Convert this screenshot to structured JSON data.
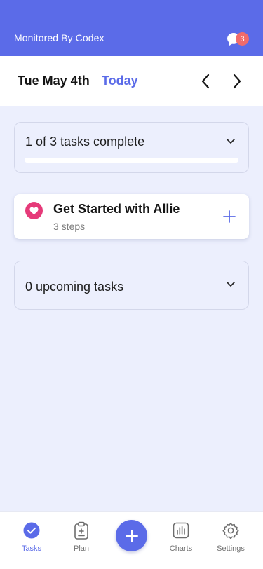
{
  "header": {
    "monitored_text": "Monitored By Codex",
    "chat_icon": "chat-bubbles-icon",
    "chat_badge_count": "3",
    "bg_color": "#5b6be8"
  },
  "date_bar": {
    "date": "Tue May 4th",
    "today_label": "Today",
    "prev_icon": "chevron-left-icon",
    "next_icon": "chevron-right-icon"
  },
  "summary": {
    "text": "1 of 3 tasks complete",
    "progress_fraction": 0,
    "expand_icon": "chevron-down-icon"
  },
  "task": {
    "title": "Get Started with Allie",
    "subtitle": "3 steps",
    "icon": "heart-icon",
    "icon_color": "#e63a79",
    "add_icon": "plus-icon"
  },
  "upcoming": {
    "text": "0 upcoming tasks",
    "expand_icon": "chevron-down-icon"
  },
  "bottom_nav": {
    "items": [
      {
        "label": "Tasks",
        "icon": "check-circle-icon",
        "active": true
      },
      {
        "label": "Plan",
        "icon": "clipboard-icon",
        "active": false
      },
      {
        "label": "Charts",
        "icon": "bar-chart-icon",
        "active": false
      },
      {
        "label": "Settings",
        "icon": "gear-icon",
        "active": false
      }
    ],
    "fab_icon": "plus-icon"
  },
  "colors": {
    "accent": "#5b6be8",
    "background": "#eceffd",
    "badge": "#f06b6b"
  }
}
